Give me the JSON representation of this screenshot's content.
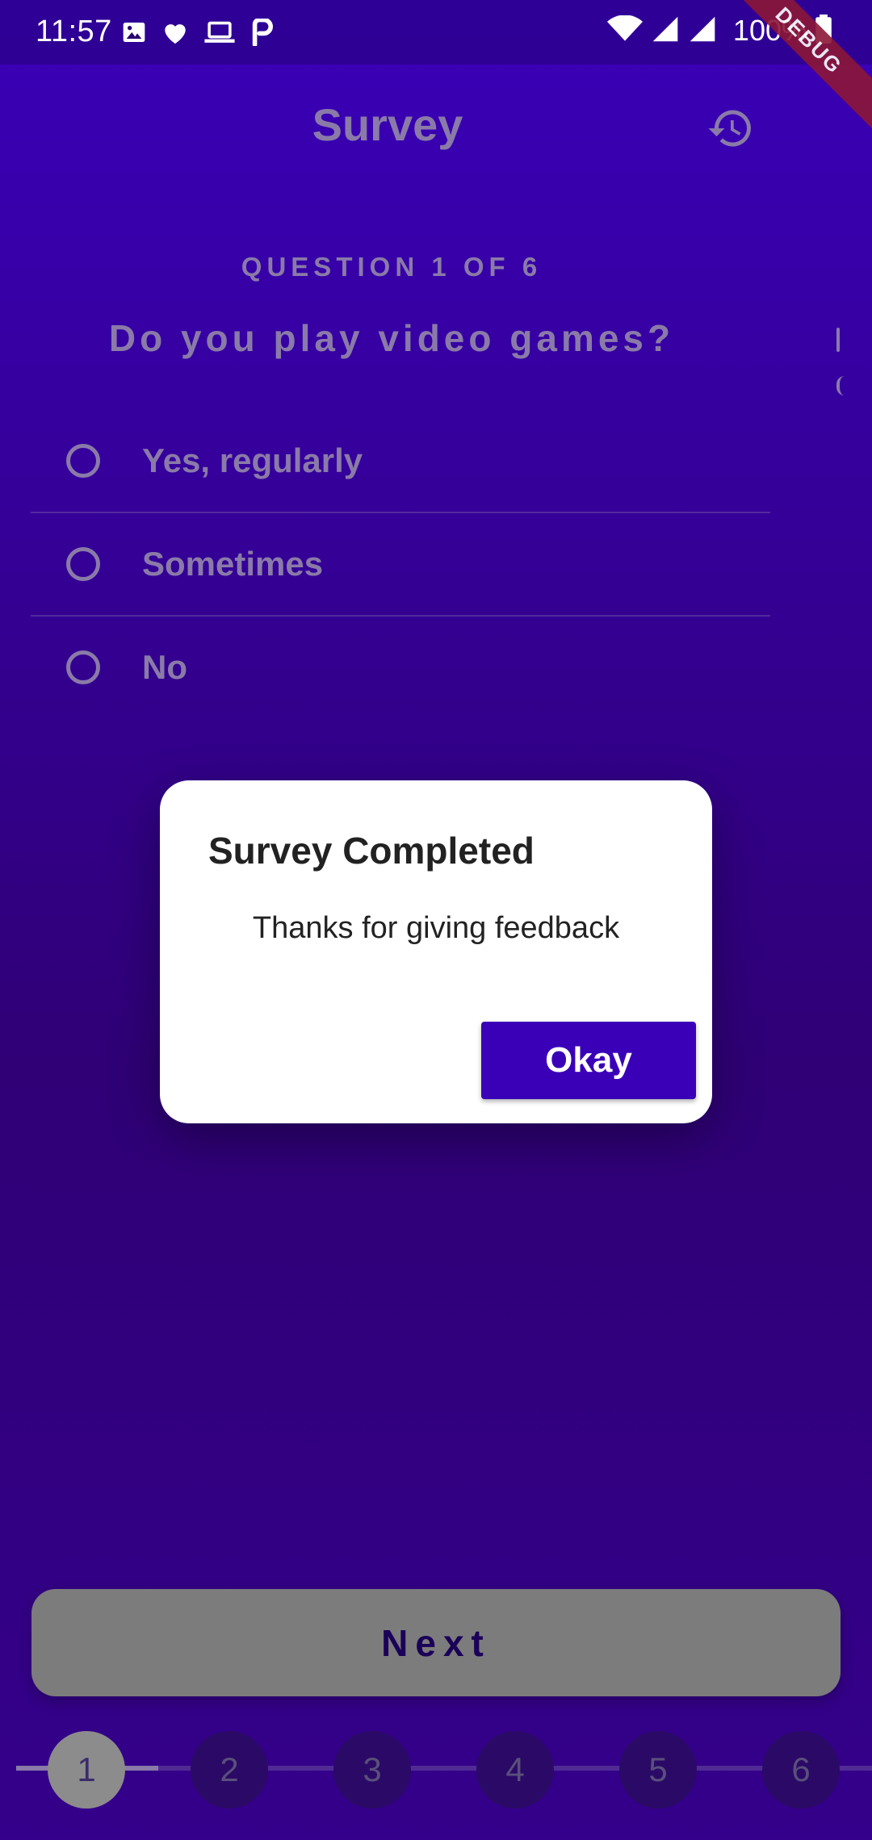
{
  "status_bar": {
    "time": "11:57",
    "battery": "100%",
    "icons_left": [
      "image-icon",
      "heart-icon",
      "laptop-icon",
      "p-icon"
    ],
    "icons_right": [
      "wifi-icon",
      "signal-icon",
      "signal-icon-2",
      "battery-icon"
    ]
  },
  "debug_banner": "DEBUG",
  "header": {
    "title": "Survey",
    "history_icon": "history-icon"
  },
  "question": {
    "counter": "QUESTION 1 OF 6",
    "text": "Do you play video games?",
    "options": [
      {
        "label": "Yes, regularly"
      },
      {
        "label": "Sometimes"
      },
      {
        "label": "No"
      }
    ]
  },
  "dialog": {
    "title": "Survey Completed",
    "message": "Thanks for giving feedback",
    "button": "Okay"
  },
  "next_button": "Next",
  "stepper": {
    "steps": [
      "1",
      "2",
      "3",
      "4",
      "5",
      "6"
    ],
    "current": "1"
  },
  "colors": {
    "background_top": "#3A00B8",
    "background_bottom": "#2F0076",
    "primary": "#3A00B8",
    "muted_text": "#8A7AA8",
    "dialog_bg": "#FFFFFF"
  }
}
